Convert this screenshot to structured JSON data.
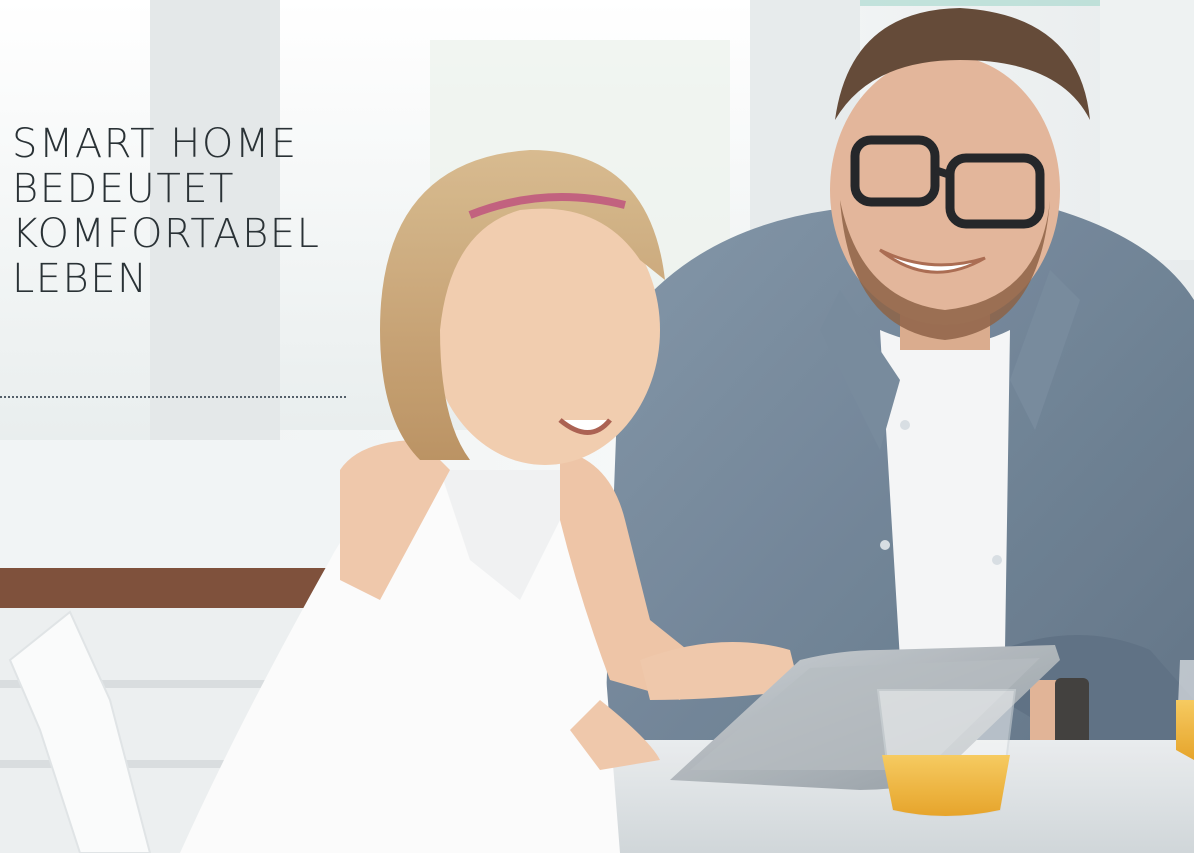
{
  "headline": {
    "lines": [
      "SMART HOME",
      "BEDEUTET",
      "KOMFORTABEL",
      "LEBEN"
    ],
    "color": "#2a3236"
  },
  "photo": {
    "description_icon": "photo-father-daughter-tablet",
    "accent_colors": {
      "window_light": "#f2f6f7",
      "denim_shirt": "#6a7e92",
      "wood_trim": "#7a4a35",
      "orange_juice": "#f2b23a"
    }
  }
}
